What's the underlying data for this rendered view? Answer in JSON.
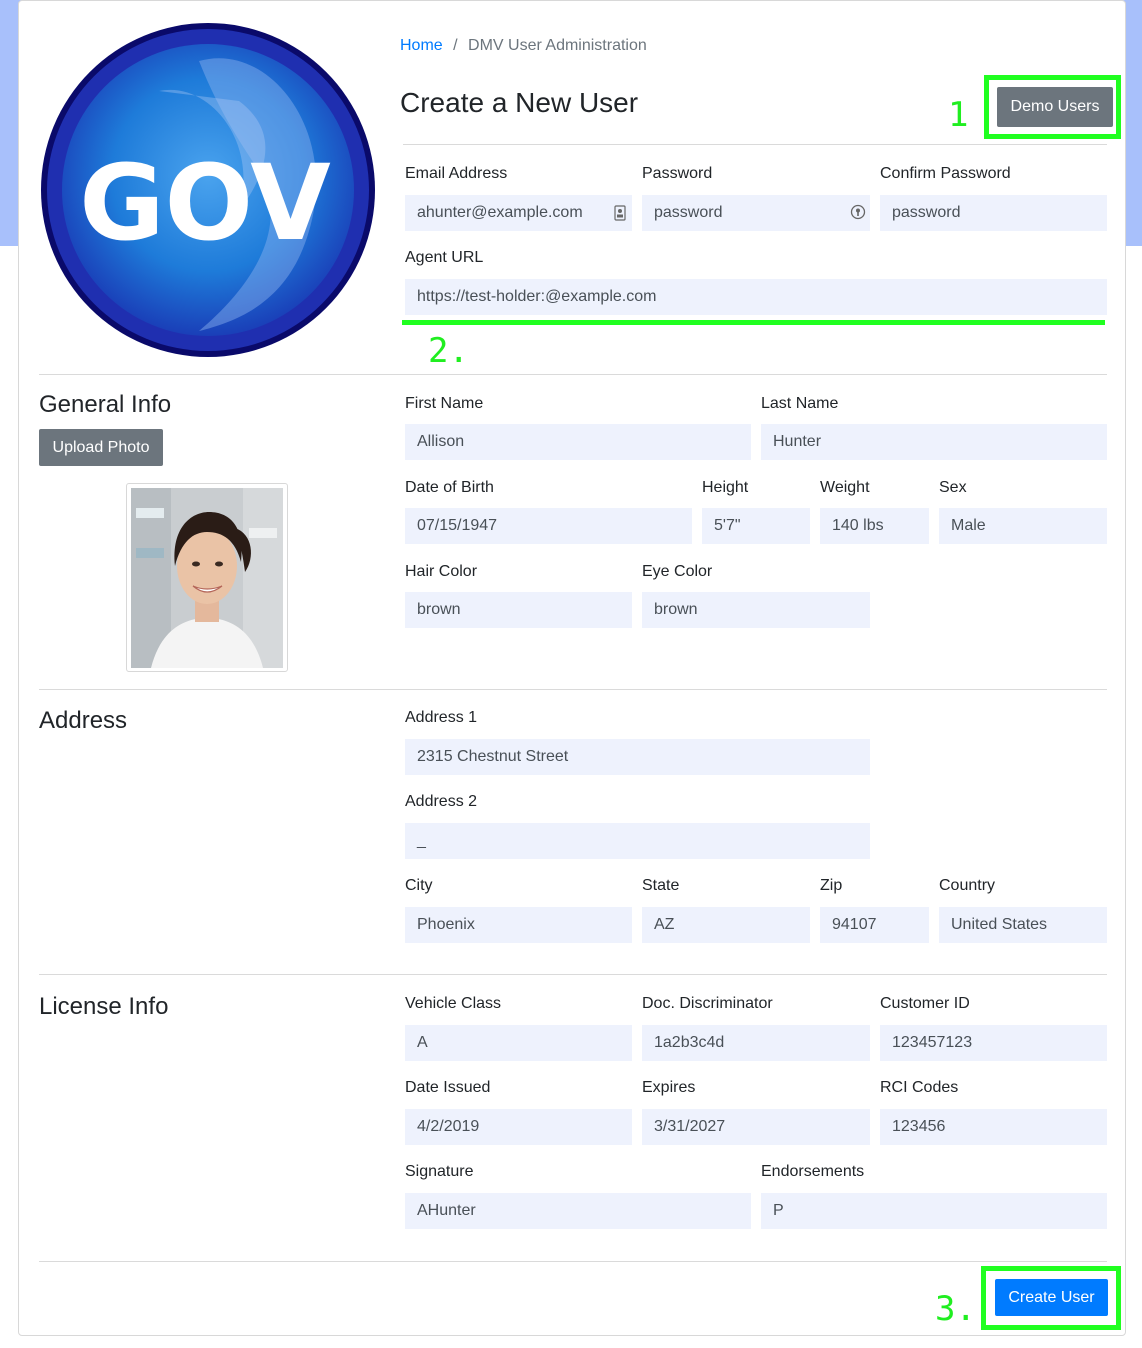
{
  "breadcrumb": {
    "home": "Home",
    "separator": "/",
    "current": "DMV User Administration"
  },
  "logo": {
    "text": "GOV"
  },
  "page_title": "Create a New User",
  "demo_users_button": "Demo Users",
  "annotations": {
    "one": "1",
    "two": "2.",
    "three": "3."
  },
  "account": {
    "email": {
      "label": "Email Address",
      "value": "ahunter@example.com"
    },
    "password": {
      "label": "Password",
      "value": "password"
    },
    "confirm_password": {
      "label": "Confirm Password",
      "value": "password"
    },
    "agent_url": {
      "label": "Agent URL",
      "value": "https://test-holder:@example.com"
    }
  },
  "general_info": {
    "title": "General Info",
    "upload_photo": "Upload Photo",
    "first_name": {
      "label": "First Name",
      "value": "Allison"
    },
    "last_name": {
      "label": "Last Name",
      "value": "Hunter"
    },
    "dob": {
      "label": "Date of Birth",
      "value": "07/15/1947"
    },
    "height": {
      "label": "Height",
      "value": "5'7\""
    },
    "weight": {
      "label": "Weight",
      "value": "140 lbs"
    },
    "sex": {
      "label": "Sex",
      "value": "Male"
    },
    "hair_color": {
      "label": "Hair Color",
      "value": "brown"
    },
    "eye_color": {
      "label": "Eye Color",
      "value": "brown"
    }
  },
  "address": {
    "title": "Address",
    "address1": {
      "label": "Address 1",
      "value": "2315 Chestnut Street"
    },
    "address2": {
      "label": "Address 2",
      "value": "_"
    },
    "city": {
      "label": "City",
      "value": "Phoenix"
    },
    "state": {
      "label": "State",
      "value": "AZ"
    },
    "zip": {
      "label": "Zip",
      "value": "94107"
    },
    "country": {
      "label": "Country",
      "value": "United States"
    }
  },
  "license_info": {
    "title": "License Info",
    "vehicle_class": {
      "label": "Vehicle Class",
      "value": "A"
    },
    "doc_discriminator": {
      "label": "Doc. Discriminator",
      "value": "1a2b3c4d"
    },
    "customer_id": {
      "label": "Customer ID",
      "value": "123457123"
    },
    "date_issued": {
      "label": "Date Issued",
      "value": "4/2/2019"
    },
    "expires": {
      "label": "Expires",
      "value": "3/31/2027"
    },
    "rci_codes": {
      "label": "RCI Codes",
      "value": "123456"
    },
    "signature": {
      "label": "Signature",
      "value": "AHunter"
    },
    "endorsements": {
      "label": "Endorsements",
      "value": "P"
    }
  },
  "create_user_button": "Create User",
  "colors": {
    "primary": "#007bff",
    "secondary": "#6c757d",
    "input_bg": "#eef2fd",
    "annotation_green": "#20ff20",
    "background_band": "#a8c0fb",
    "logo_blue": "#1a1aa8"
  }
}
